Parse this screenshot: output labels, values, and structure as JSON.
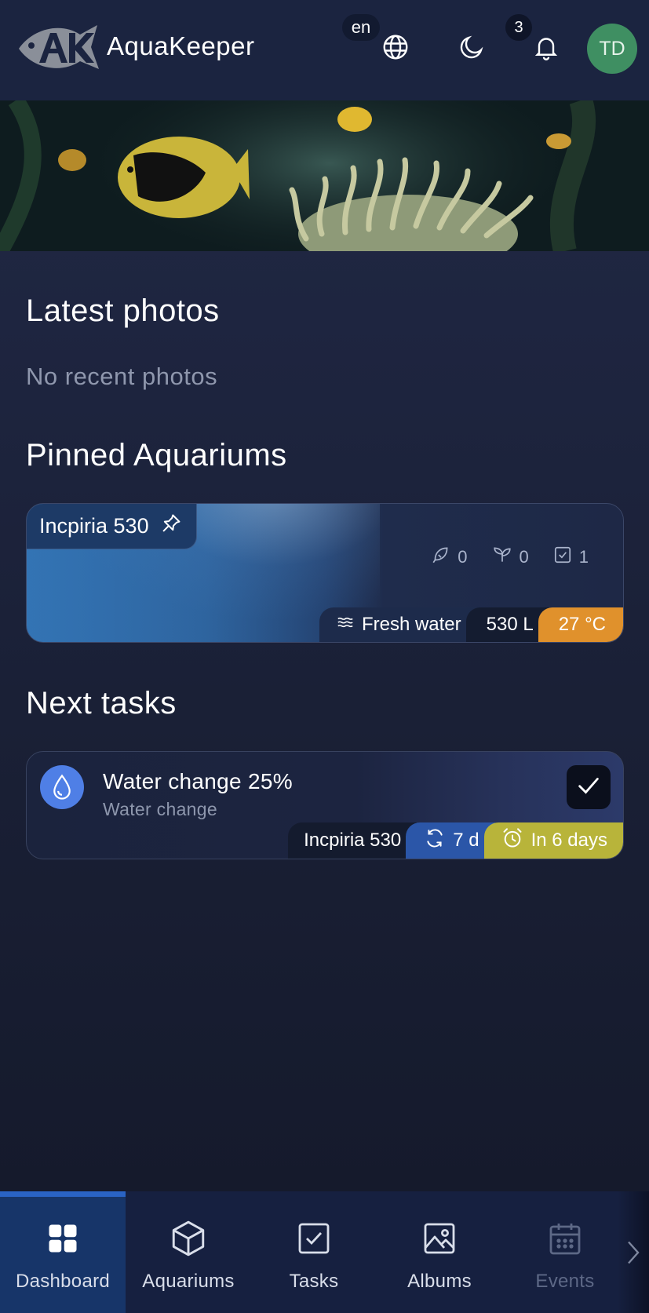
{
  "header": {
    "app_name": "AquaKeeper",
    "language": "en",
    "notification_count": "3",
    "avatar_initials": "TD"
  },
  "sections": {
    "latest_photos": {
      "title": "Latest photos",
      "empty_text": "No recent photos"
    },
    "pinned": {
      "title": "Pinned Aquariums"
    },
    "tasks": {
      "title": "Next tasks"
    }
  },
  "aquarium": {
    "name": "Incpiria 530",
    "fish_count": "0",
    "plant_count": "0",
    "task_count": "1",
    "water_type": "Fresh water",
    "volume": "530 L",
    "temperature": "27 °C"
  },
  "task": {
    "title": "Water change 25%",
    "type": "Water change",
    "aquarium": "Incpiria 530",
    "repeat": "7 d",
    "due": "In 6 days"
  },
  "nav": {
    "items": [
      {
        "label": "Dashboard",
        "icon": "dashboard-icon",
        "active": true
      },
      {
        "label": "Aquariums",
        "icon": "cube-icon"
      },
      {
        "label": "Tasks",
        "icon": "checkbox-icon"
      },
      {
        "label": "Albums",
        "icon": "image-icon"
      },
      {
        "label": "Events",
        "icon": "calendar-icon",
        "disabled": true
      }
    ]
  },
  "colors": {
    "header_bg": "#1b2440",
    "accent_blue": "#2a63c4",
    "temp_orange": "#e0912c",
    "due_yellow": "#b8b43a",
    "avatar_green": "#3f8f62"
  }
}
